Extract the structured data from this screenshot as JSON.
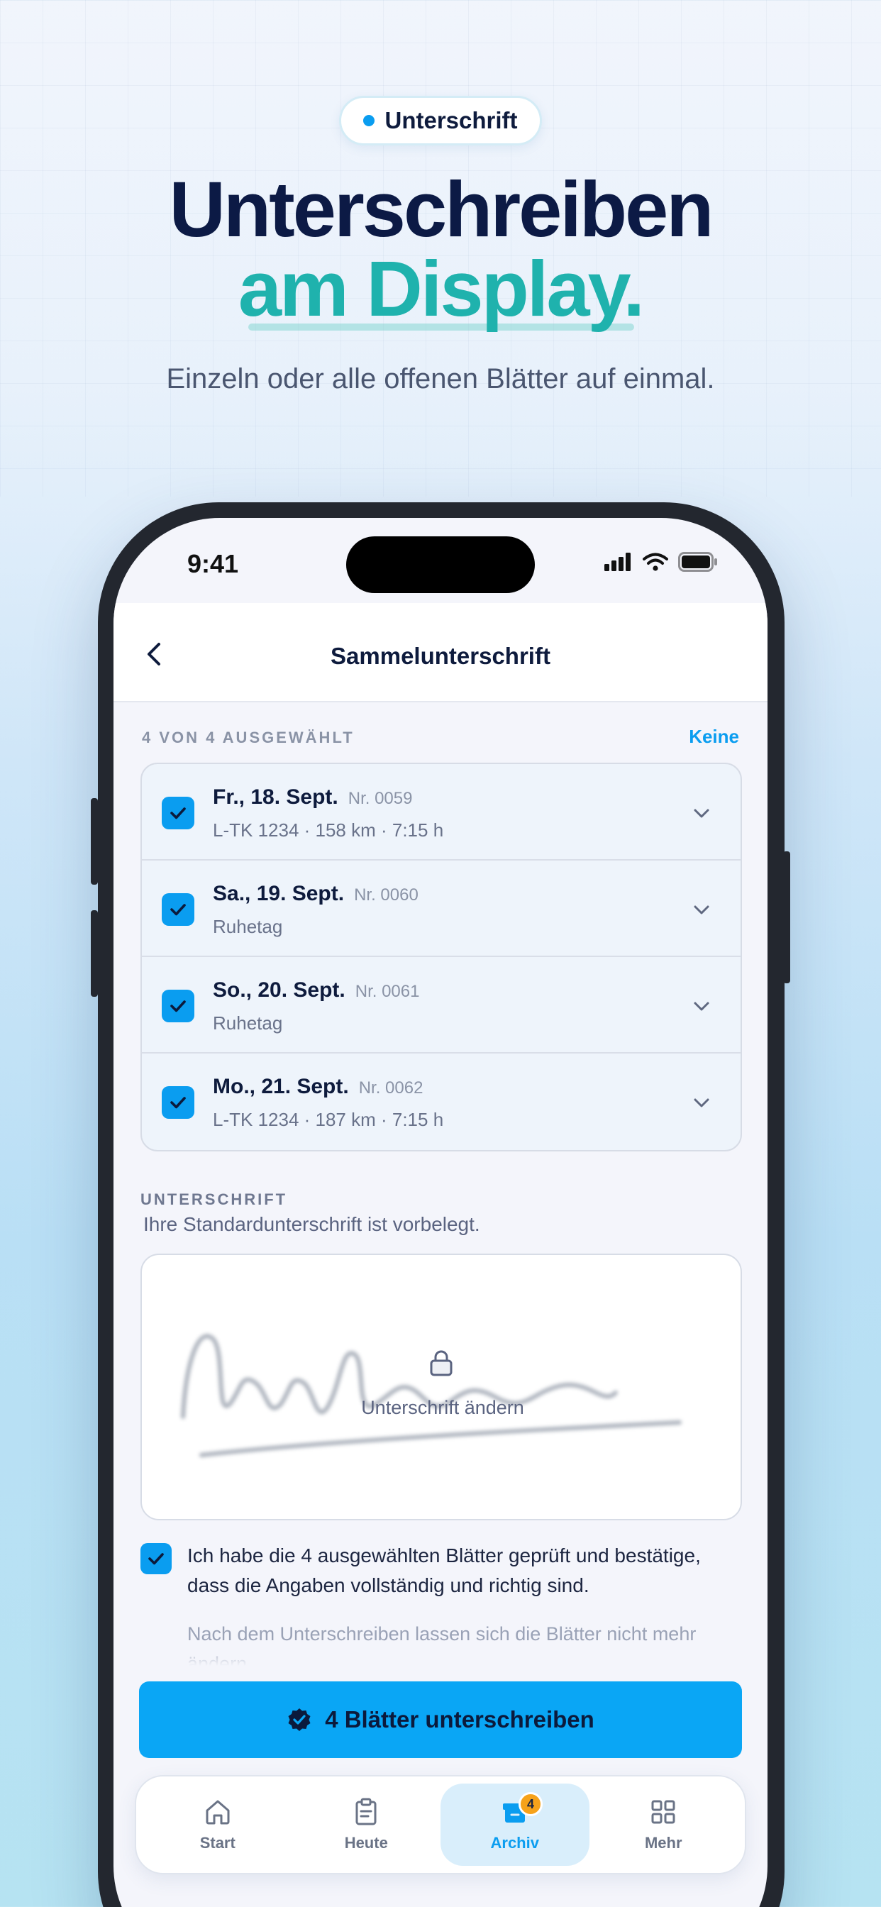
{
  "hero": {
    "badge": "Unterschrift",
    "headline_line1": "Unterschreiben",
    "headline_line2": "am Display.",
    "subline": "Einzeln oder alle offenen Blätter auf einmal."
  },
  "status_bar": {
    "time": "9:41"
  },
  "nav": {
    "title": "Sammelunterschrift"
  },
  "selection": {
    "header": "4 VON 4 AUSGEWÄHLT",
    "deselect_label": "Keine",
    "items": [
      {
        "date": "Fr., 18. Sept.",
        "nr": "Nr. 0059",
        "detail": "L-TK 1234 · 158 km · 7:15 h",
        "checked": true
      },
      {
        "date": "Sa., 19. Sept.",
        "nr": "Nr. 0060",
        "detail": "Ruhetag",
        "checked": true
      },
      {
        "date": "So., 20. Sept.",
        "nr": "Nr. 0061",
        "detail": "Ruhetag",
        "checked": true
      },
      {
        "date": "Mo., 21. Sept.",
        "nr": "Nr. 0062",
        "detail": "L-TK 1234 · 187 km · 7:15 h",
        "checked": true
      }
    ]
  },
  "signature": {
    "header": "UNTERSCHRIFT",
    "hint": "Ihre Standardunterschrift ist vorbelegt.",
    "change_label": "Unterschrift ändern"
  },
  "confirmation": {
    "checked": true,
    "text": "Ich habe die 4 ausgewählten Blätter geprüft und bestätige, dass die Angaben vollständig und richtig sind.",
    "note": "Nach dem Unterschreiben lassen sich die Blätter nicht mehr ändern."
  },
  "cta": {
    "label": "4 Blätter unterschreiben"
  },
  "tabbar": {
    "tabs": [
      {
        "label": "Start",
        "icon": "home-icon"
      },
      {
        "label": "Heute",
        "icon": "clipboard-icon"
      },
      {
        "label": "Archiv",
        "icon": "archive-icon",
        "badge": "4",
        "active": true
      },
      {
        "label": "Mehr",
        "icon": "grid-icon"
      }
    ]
  },
  "colors": {
    "accent": "#0a9df0",
    "teal": "#1fb2ad",
    "navy": "#0c1a45",
    "badge_orange": "#f6a21a"
  }
}
